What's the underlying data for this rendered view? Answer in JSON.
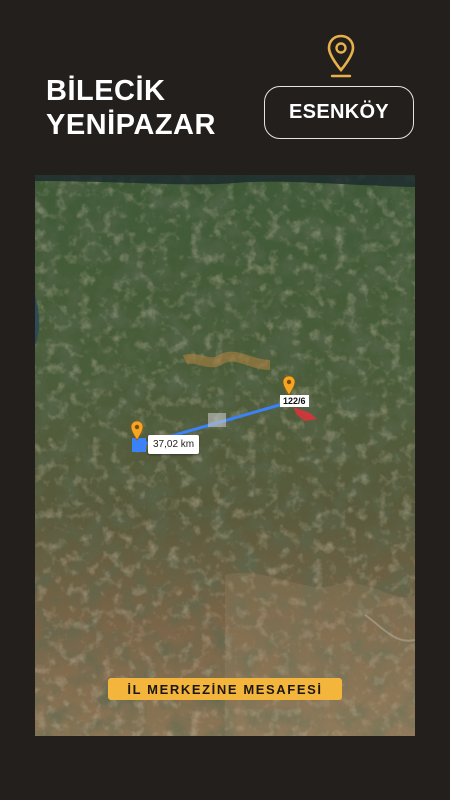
{
  "header": {
    "title_line1": "BİLECİK",
    "title_line2": "YENİPAZAR",
    "location_badge": "ESENKÖY",
    "location_icon": "map-pin-icon"
  },
  "map": {
    "distance_label": "37,02 km",
    "parcel_label": "122/6",
    "banner": "İL MERKEZİNE MESAFESİ",
    "colors": {
      "route": "#3b82f6",
      "pin": "#f5a524",
      "parcel": "#d8343c",
      "banner": "#f3b53c"
    }
  }
}
